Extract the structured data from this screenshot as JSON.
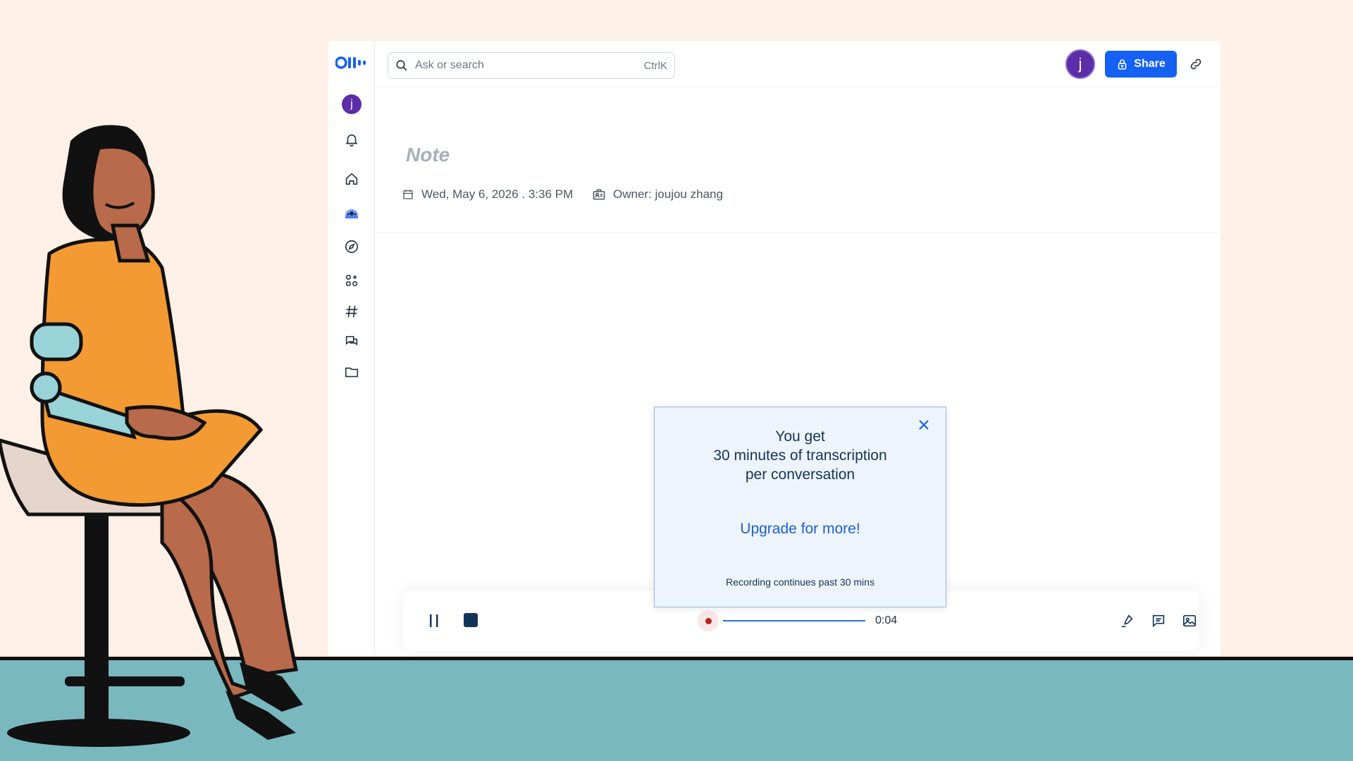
{
  "colors": {
    "background": "#fdf0e6",
    "floor": "#79b8bf",
    "accent": "#1560f5",
    "avatar": "#5b2da6",
    "recording": "#b3261e"
  },
  "brand": {
    "logo_icon": "otter-logo-icon"
  },
  "sidebar": {
    "avatar_initial": "j",
    "items": [
      {
        "icon": "bell-icon"
      },
      {
        "icon": "home-icon"
      },
      {
        "icon": "otter-assistant-icon"
      },
      {
        "icon": "compass-icon"
      },
      {
        "icon": "apps-add-icon"
      },
      {
        "icon": "hash-icon"
      },
      {
        "icon": "chat-icon"
      },
      {
        "icon": "folder-icon"
      }
    ]
  },
  "search": {
    "placeholder": "Ask or search",
    "shortcut": "CtrlK"
  },
  "header": {
    "avatar_initial": "j",
    "share_label": "Share"
  },
  "note": {
    "title": "Note",
    "date": "Wed, May 6, 2026 . 3:36 PM",
    "owner": "Owner: joujou zhang"
  },
  "popup": {
    "line1": "You get",
    "line2": "30 minutes of transcription",
    "line3": "per conversation",
    "cta": "Upgrade for more!",
    "footer": "Recording continues past 30 mins"
  },
  "player": {
    "elapsed": "0:04",
    "state": "recording"
  }
}
